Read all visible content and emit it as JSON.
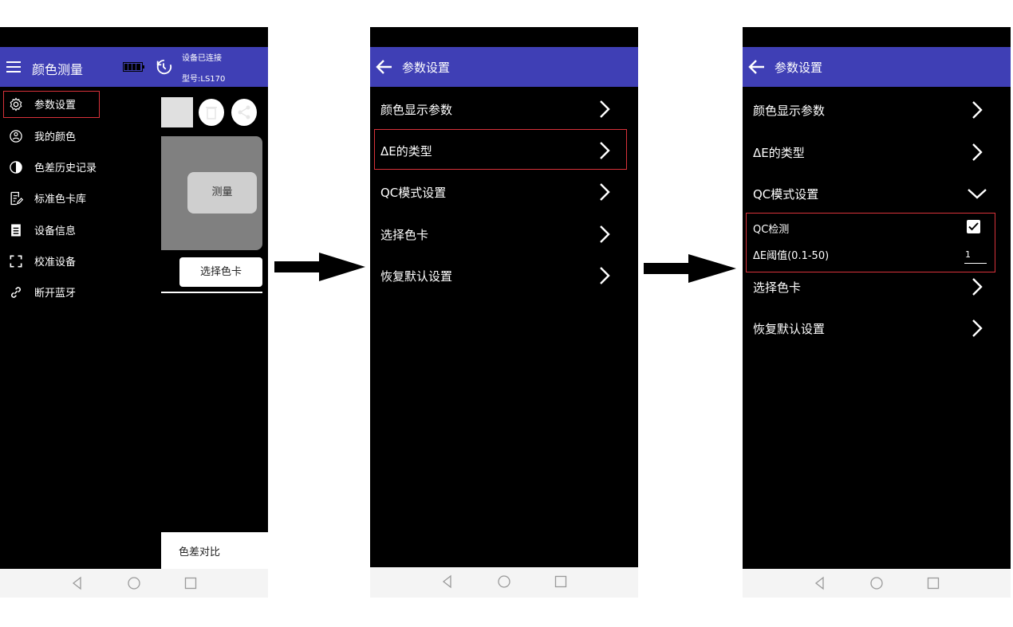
{
  "screen1": {
    "title": "颜色测量",
    "status_connected": "设备已连接",
    "status_model": "型号:LS170",
    "drawer_items": [
      {
        "label": "参数设置",
        "icon": "gear-icon"
      },
      {
        "label": "我的颜色",
        "icon": "person-icon"
      },
      {
        "label": "色差历史记录",
        "icon": "contrast-icon"
      },
      {
        "label": "标准色卡库",
        "icon": "document-edit-icon"
      },
      {
        "label": "设备信息",
        "icon": "info-list-icon"
      },
      {
        "label": "校准设备",
        "icon": "calibrate-icon"
      },
      {
        "label": "断开蓝牙",
        "icon": "link-icon"
      }
    ],
    "measure_label": "测量",
    "select_card_label": "选择色卡",
    "compare_label": "色差对比"
  },
  "screen2": {
    "title": "参数设置",
    "items": [
      "颜色显示参数",
      "ΔE的类型",
      "QC模式设置",
      "选择色卡",
      "恢复默认设置"
    ]
  },
  "screen3": {
    "title": "参数设置",
    "items": [
      "颜色显示参数",
      "ΔE的类型",
      "QC模式设置",
      "选择色卡",
      "恢复默认设置"
    ],
    "qc_check_label": "QC检测",
    "qc_check_checked": true,
    "threshold_label": "ΔE阈值(0.1-50)",
    "threshold_value": "1"
  },
  "colors": {
    "appbar": "#3f3fb5",
    "highlight": "#d8323a",
    "background": "#000000"
  }
}
